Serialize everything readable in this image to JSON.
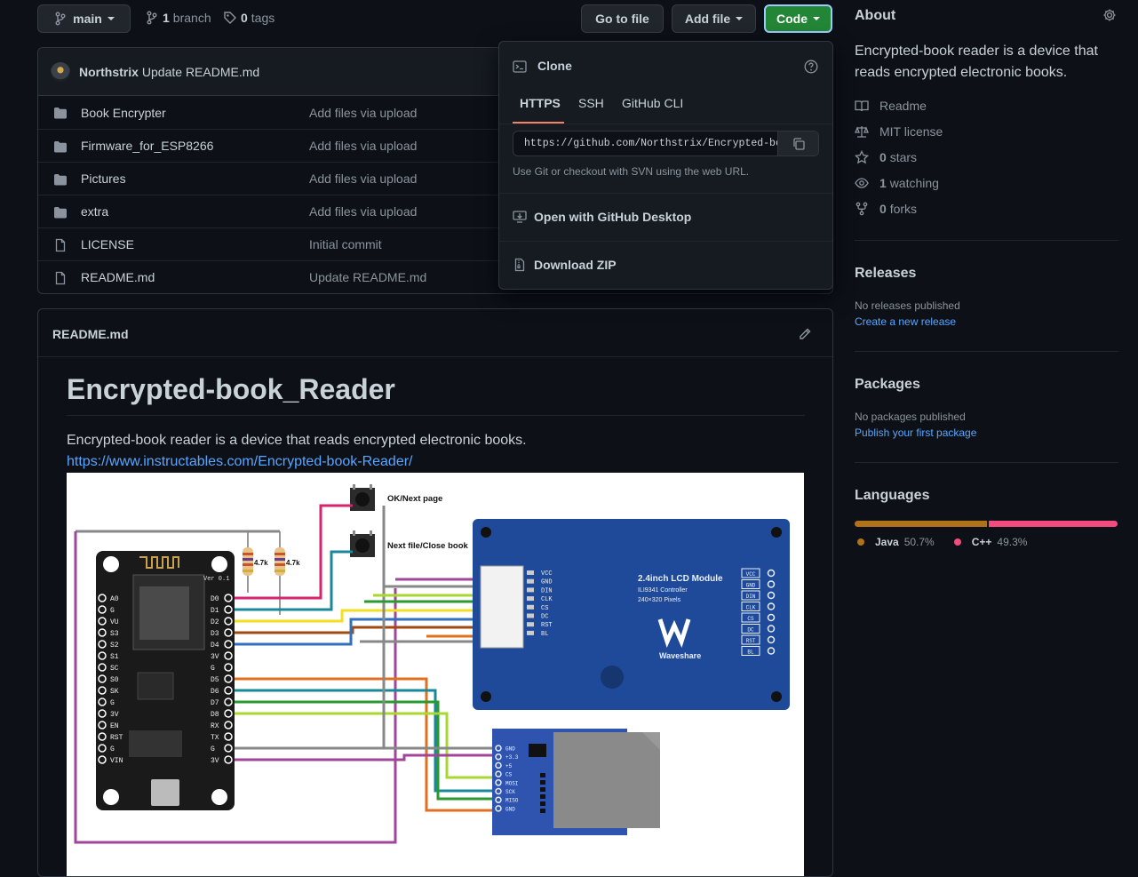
{
  "toolbar": {
    "branch": "main",
    "branches_count": "1",
    "branches_label": "branch",
    "tags_count": "0",
    "tags_label": "tags",
    "go_to_file": "Go to file",
    "add_file": "Add file",
    "code": "Code"
  },
  "commit": {
    "author": "Northstrix",
    "message": "Update README.md"
  },
  "files": [
    {
      "name": "Book Encrypter",
      "message": "Add files via upload",
      "type": "folder"
    },
    {
      "name": "Firmware_for_ESP8266",
      "message": "Add files via upload",
      "type": "folder"
    },
    {
      "name": "Pictures",
      "message": "Add files via upload",
      "type": "folder"
    },
    {
      "name": "extra",
      "message": "Add files via upload",
      "type": "folder"
    },
    {
      "name": "LICENSE",
      "message": "Initial commit",
      "type": "file"
    },
    {
      "name": "README.md",
      "message": "Update README.md",
      "type": "file"
    }
  ],
  "clone": {
    "title": "Clone",
    "tabs": [
      "HTTPS",
      "SSH",
      "GitHub CLI"
    ],
    "active_tab": "HTTPS",
    "url": "https://github.com/Northstrix/Encrypted-book_Reader.git",
    "url_visible": "https://github.com/Northstrix/Encrypted-bo",
    "hint": "Use Git or checkout with SVN using the web URL.",
    "open_desktop": "Open with GitHub Desktop",
    "download_zip": "Download ZIP"
  },
  "readme": {
    "filename": "README.md",
    "title": "Encrypted-book_Reader",
    "description": "Encrypted-book reader is a device that reads encrypted electronic books.",
    "link": "https://www.instructables.com/Encrypted-book-Reader/"
  },
  "diagram": {
    "button1": "OK/Next page",
    "button2": "Next file/Close book",
    "resistor": "4.7k",
    "mcu_pins_right": [
      "D0",
      "D1",
      "D2",
      "D3",
      "D4",
      "3V",
      "G",
      "D5",
      "D6",
      "D7",
      "D8",
      "RX",
      "TX",
      "G",
      "3V"
    ],
    "mcu_pins_left": [
      "A0",
      "G",
      "VU",
      "S3",
      "S2",
      "S1",
      "SC",
      "S0",
      "SK",
      "G",
      "3V",
      "EN",
      "RST",
      "G",
      "VIN"
    ],
    "mcu_version": "Ver 0.1",
    "lcd_title": "2.4inch LCD Module",
    "lcd_controller": "ILI9341 Controller",
    "lcd_pixels": "240×320 Pixels",
    "lcd_brand": "Waveshare",
    "lcd_pins": [
      "VCC",
      "GND",
      "DIN",
      "CLK",
      "CS",
      "DC",
      "RST",
      "BL"
    ],
    "sd_pins": [
      "GND",
      "+3.3",
      "+5",
      "CS",
      "MOSI",
      "SCK",
      "MISO",
      "GND"
    ]
  },
  "about": {
    "title": "About",
    "description": "Encrypted-book reader is a device that reads encrypted electronic books.",
    "readme": "Readme",
    "license": "MIT license",
    "stars": "0",
    "stars_label": "stars",
    "watching": "1",
    "watching_label": "watching",
    "forks": "0",
    "forks_label": "forks"
  },
  "releases": {
    "title": "Releases",
    "none": "No releases published",
    "create": "Create a new release"
  },
  "packages": {
    "title": "Packages",
    "none": "No packages published",
    "publish": "Publish your first package"
  },
  "languages": {
    "title": "Languages",
    "items": [
      {
        "name": "Java",
        "percent": "50.7%",
        "value": 50.7,
        "color": "#b07219"
      },
      {
        "name": "C++",
        "percent": "49.3%",
        "value": 49.3,
        "color": "#f34b7d"
      }
    ]
  },
  "colors": {
    "accent": "#58a6ff",
    "code_button": "#238636",
    "background": "#0d1117"
  }
}
